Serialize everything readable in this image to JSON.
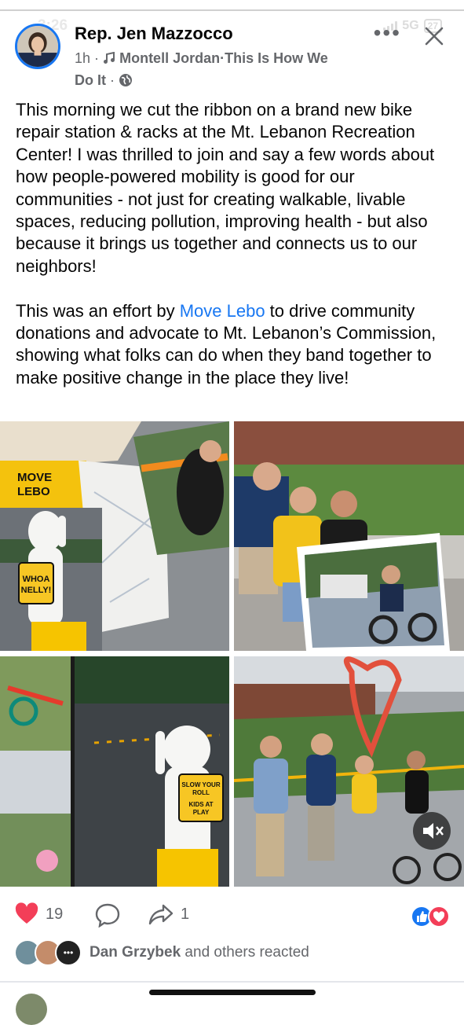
{
  "status_bar": {
    "time": "3:26",
    "network": "5G",
    "battery": "27"
  },
  "post": {
    "author": "Rep. Jen Mazzocco",
    "time": "1h",
    "dot": "·",
    "song": "Montell Jordan",
    "song_title_line1": "This Is How We",
    "song_title_line2": "Do It",
    "paragraph1": "This morning we cut the ribbon on a brand new bike repair station & racks at the Mt. Lebanon Recreation Center! I was thrilled to join and say a few words about how people-powered mobility is good for our communities - not just for creating walkable, livable spaces, reducing pollution, improving health - but also because it brings us together and connects us to our neighbors!",
    "paragraph2_pre": "This was an effort by ",
    "paragraph2_link": "Move Lebo",
    "paragraph2_post": " to drive community donations and advocate to Mt. Lebanon’s Commission, showing what folks can do when they band together to make positive change in the place they live!"
  },
  "photos": {
    "sign1_line1": "MOVE",
    "sign1_line2": "LEBO",
    "figure1_sign_line1": "WHOA",
    "figure1_sign_line2": "NELLY!",
    "figure2_sign_line1": "SLOW YOUR",
    "figure2_sign_line2": "ROLL",
    "figure2_sign_line3": "KIDS AT",
    "figure2_sign_line4": "PLAY"
  },
  "reactions": {
    "likes": "19",
    "shares": "1",
    "reacted_name": "Dan Grzybek",
    "reacted_suffix": " and others reacted"
  },
  "colors": {
    "accent": "#1877f2",
    "heart": "#f33e58",
    "secondary": "#65676b"
  },
  "icons": [
    "heart-outline-icon",
    "comment-icon",
    "share-icon",
    "like-reaction-icon",
    "love-reaction-icon",
    "mute-icon",
    "globe-icon",
    "music-note-icon",
    "close-icon",
    "more-icon"
  ]
}
